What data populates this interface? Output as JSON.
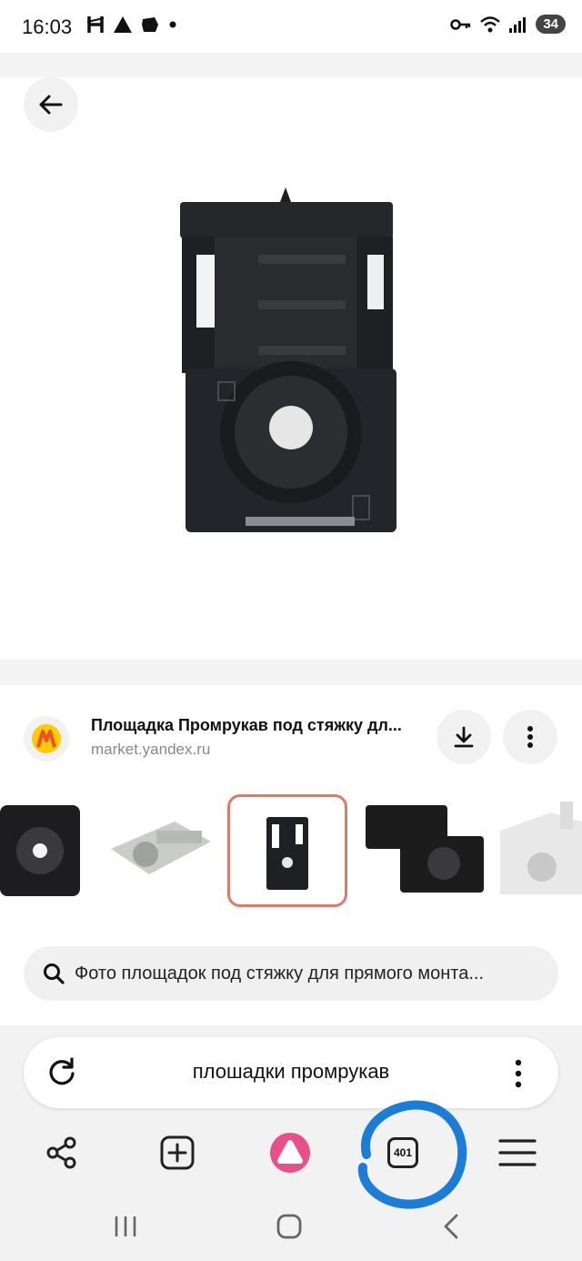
{
  "status": {
    "time": "16:03",
    "battery": "34",
    "left_icons": [
      "h-icon",
      "warning-icon",
      "cloud-icon",
      "dot-icon"
    ],
    "right_icons": [
      "key-icon",
      "wifi-icon",
      "signal-icon"
    ]
  },
  "image": {
    "subject": "black cable tie mount"
  },
  "source": {
    "title": "Площадка Промрукав под стяжку дл...",
    "url": "market.yandex.ru"
  },
  "thumbnails": [
    {
      "color": "#1d1d1f"
    },
    {
      "color": "#c9ccc8"
    },
    {
      "color": "#1f2024",
      "selected": true
    },
    {
      "color": "#1c1c1c"
    },
    {
      "color": "#e8e8e8"
    }
  ],
  "related": {
    "text": "Фото площадок под стяжку для прямого монта..."
  },
  "search": {
    "query": "плошадки промрукав"
  },
  "toolbar": {
    "tabs_count": "401"
  },
  "colors": {
    "accent_selected": "#e07a66",
    "alice": "#e9508a",
    "annotation": "#1a7ed8",
    "market_yellow": "#ffcc00",
    "market_red": "#f04f2c"
  }
}
